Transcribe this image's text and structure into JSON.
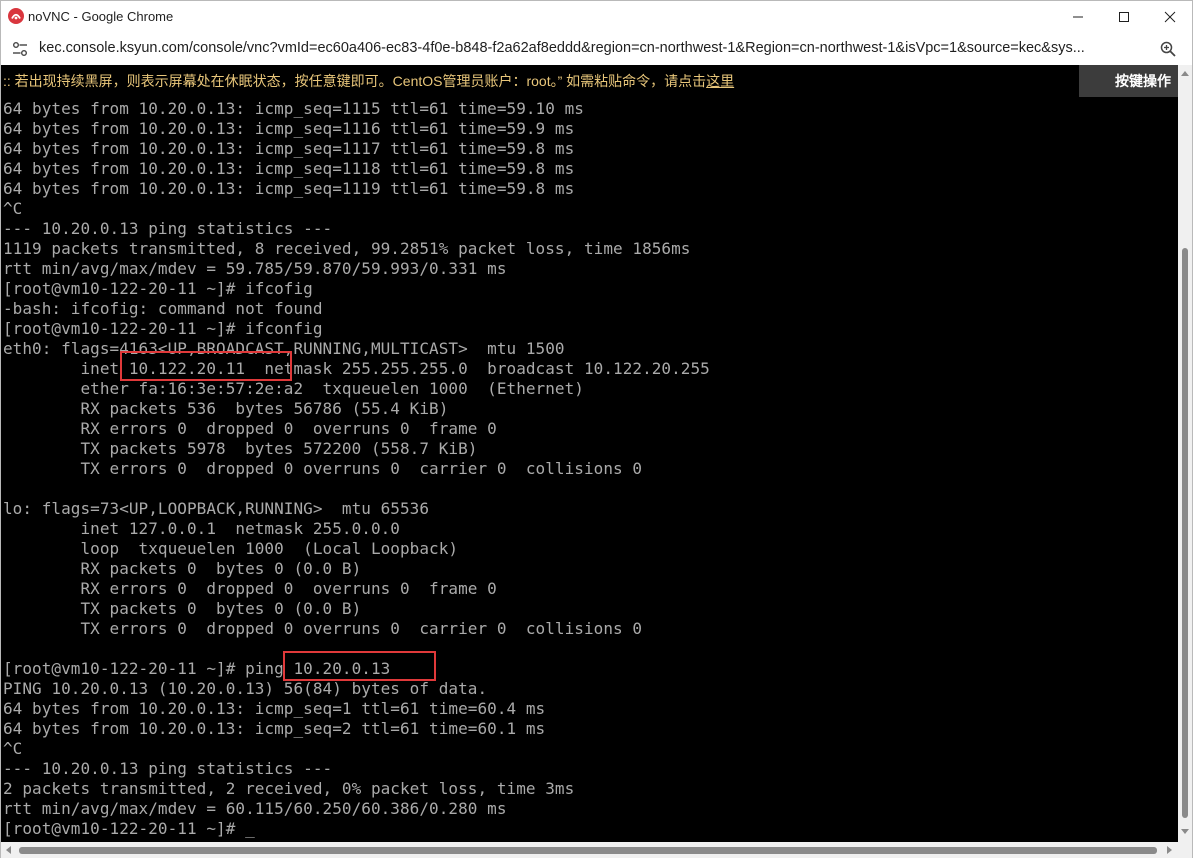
{
  "window": {
    "title": "noVNC - Google Chrome",
    "url": "kec.console.ksyun.com/console/vnc?vmId=ec60a406-ec83-4f0e-b848-f2a62af8eddd&region=cn-northwest-1&Region=cn-northwest-1&isVpc=1&source=kec&sys..."
  },
  "vnc": {
    "notice_text": ":: 若出现持续黑屏，则表示屏幕处在休眠状态，按任意键即可。CentOS管理员账户：root。” 如需粘贴命令，请点击",
    "notice_link": "这里",
    "key_ops_label": "按键操作"
  },
  "terminal": {
    "lines": [
      "64 bytes from 10.20.0.13: icmp_seq=1115 ttl=61 time=59.10 ms",
      "64 bytes from 10.20.0.13: icmp_seq=1116 ttl=61 time=59.9 ms",
      "64 bytes from 10.20.0.13: icmp_seq=1117 ttl=61 time=59.8 ms",
      "64 bytes from 10.20.0.13: icmp_seq=1118 ttl=61 time=59.8 ms",
      "64 bytes from 10.20.0.13: icmp_seq=1119 ttl=61 time=59.8 ms",
      "^C",
      "--- 10.20.0.13 ping statistics ---",
      "1119 packets transmitted, 8 received, 99.2851% packet loss, time 1856ms",
      "rtt min/avg/max/mdev = 59.785/59.870/59.993/0.331 ms",
      "[root@vm10-122-20-11 ~]# ifcofig",
      "-bash: ifcofig: command not found",
      "[root@vm10-122-20-11 ~]# ifconfig",
      "eth0: flags=4163<UP,BROADCAST,RUNNING,MULTICAST>  mtu 1500",
      "        inet 10.122.20.11  netmask 255.255.255.0  broadcast 10.122.20.255",
      "        ether fa:16:3e:57:2e:a2  txqueuelen 1000  (Ethernet)",
      "        RX packets 536  bytes 56786 (55.4 KiB)",
      "        RX errors 0  dropped 0  overruns 0  frame 0",
      "        TX packets 5978  bytes 572200 (558.7 KiB)",
      "        TX errors 0  dropped 0 overruns 0  carrier 0  collisions 0",
      "",
      "lo: flags=73<UP,LOOPBACK,RUNNING>  mtu 65536",
      "        inet 127.0.0.1  netmask 255.0.0.0",
      "        loop  txqueuelen 1000  (Local Loopback)",
      "        RX packets 0  bytes 0 (0.0 B)",
      "        RX errors 0  dropped 0  overruns 0  frame 0",
      "        TX packets 0  bytes 0 (0.0 B)",
      "        TX errors 0  dropped 0 overruns 0  carrier 0  collisions 0",
      "",
      "[root@vm10-122-20-11 ~]# ping 10.20.0.13",
      "PING 10.20.0.13 (10.20.0.13) 56(84) bytes of data.",
      "64 bytes from 10.20.0.13: icmp_seq=1 ttl=61 time=60.4 ms",
      "64 bytes from 10.20.0.13: icmp_seq=2 ttl=61 time=60.1 ms",
      "^C",
      "--- 10.20.0.13 ping statistics ---",
      "2 packets transmitted, 2 received, 0% packet loss, time 3ms",
      "rtt min/avg/max/mdev = 60.115/60.250/60.386/0.280 ms",
      "[root@vm10-122-20-11 ~]# _"
    ]
  },
  "colors": {
    "terminal_bg": "#000000",
    "terminal_fg": "#aaaaaa",
    "notice_fg": "#e8c67a",
    "highlight": "#e0393a"
  }
}
